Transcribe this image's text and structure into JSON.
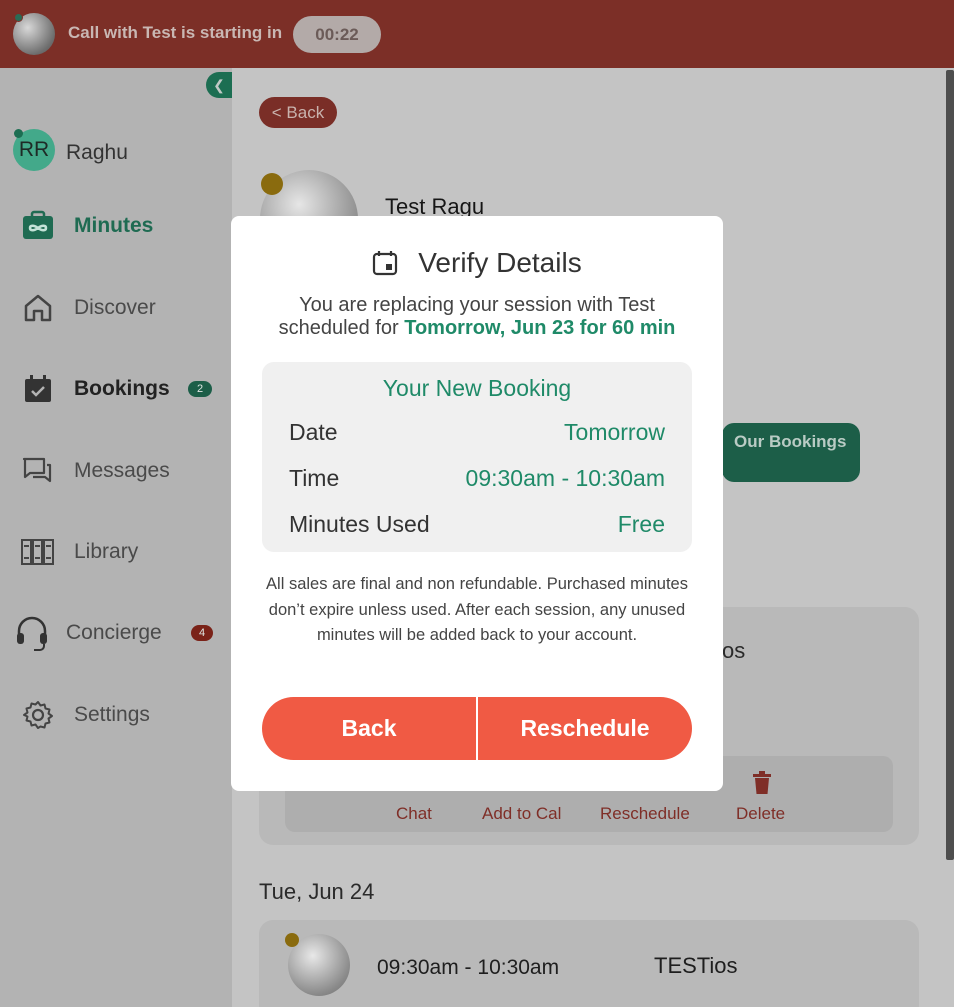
{
  "banner": {
    "text": "Call with Test is starting in",
    "timer": "00:22"
  },
  "sidebar": {
    "user": {
      "initials": "RR",
      "name": "Raghu"
    },
    "items": [
      {
        "label": "Minutes",
        "icon": "minutes-icon"
      },
      {
        "label": "Discover",
        "icon": "home-icon"
      },
      {
        "label": "Bookings",
        "icon": "calendar-check-icon",
        "badge": "2"
      },
      {
        "label": "Messages",
        "icon": "chat-icon"
      },
      {
        "label": "Library",
        "icon": "library-icon"
      },
      {
        "label": "Concierge",
        "icon": "headset-icon",
        "badge": "4"
      },
      {
        "label": "Settings",
        "icon": "gear-icon"
      }
    ]
  },
  "main": {
    "back_label": "< Back",
    "profile_name": "Test Ragu",
    "our_bookings_label": "Our Bookings",
    "card_partial_text": "os",
    "actions": [
      "Chat",
      "Add to Cal",
      "Reschedule",
      "Delete"
    ],
    "date_heading": "Tue, Jun 24",
    "next_booking": {
      "time": "09:30am - 10:30am",
      "name": "TESTios"
    }
  },
  "modal": {
    "title": "Verify Details",
    "subtitle_prefix": "You are replacing your session with Test scheduled for",
    "subtitle_highlight": "Tomorrow, Jun 23 for 60 min",
    "box_title": "Your New Booking",
    "rows": [
      {
        "label": "Date",
        "value": "Tomorrow"
      },
      {
        "label": "Time",
        "value": "09:30am - 10:30am"
      },
      {
        "label": "Minutes Used",
        "value": "Free"
      }
    ],
    "disclaimer": "All sales are final and non refundable. Purchased minutes don’t expire unless used. After each session, any unused minutes will be added back to your account.",
    "back_button": "Back",
    "reschedule_button": "Reschedule"
  },
  "colors": {
    "accent_green": "#1f8a68",
    "button_red": "#f05a44",
    "banner_red": "#7c2f27"
  }
}
